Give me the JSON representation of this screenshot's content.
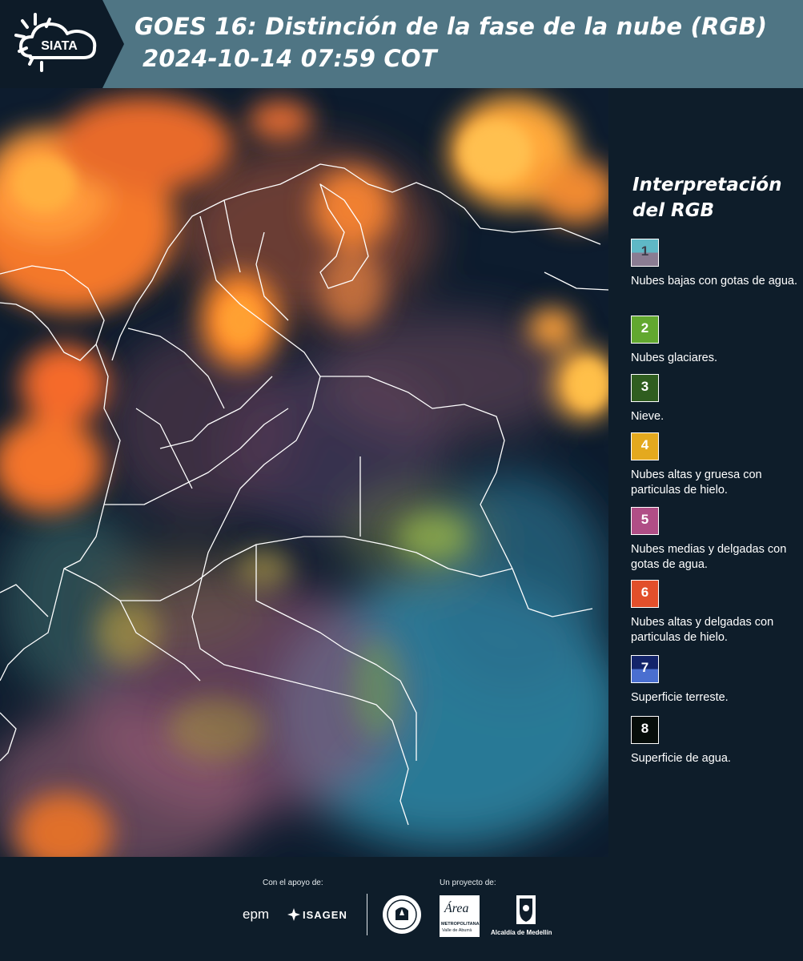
{
  "header": {
    "logo_text": "SIATA",
    "title_line1": "GOES 16: Distinción de la fase de la nube (RGB)",
    "title_line2": "2024-10-14 07:59 COT"
  },
  "legend": {
    "title_line1": "Interpretación",
    "title_line2": "del RGB",
    "items": [
      {
        "number": "1",
        "label": "Nubes bajas con gotas de agua.",
        "color_top": "#5fb8c6",
        "color_bottom": "#8a7c92",
        "number_color": "#3d3d4a"
      },
      {
        "number": "2",
        "label": "Nubes glaciares.",
        "color_top": "#62a82f",
        "color_bottom": "#62a82f",
        "number_color": "#ffffff"
      },
      {
        "number": "3",
        "label": "Nieve.",
        "color_top": "#2f5d1f",
        "color_bottom": "#2f5d1f",
        "number_color": "#ffffff"
      },
      {
        "number": "4",
        "label": "Nubes altas y gruesa con particulas de hielo.",
        "color_top": "#e4a91e",
        "color_bottom": "#e4a91e",
        "number_color": "#ffffff"
      },
      {
        "number": "5",
        "label": "Nubes medias y delgadas con gotas de agua.",
        "color_top": "#b04e86",
        "color_bottom": "#b04e86",
        "number_color": "#ffffff"
      },
      {
        "number": "6",
        "label": "Nubes altas y delgadas con particulas de hielo.",
        "color_top": "#e24f2b",
        "color_bottom": "#e24f2b",
        "number_color": "#ffffff"
      },
      {
        "number": "7",
        "label": "Superficie terreste.",
        "color_top": "#13246a",
        "color_bottom": "#4a6fd0",
        "number_color": "#ffffff"
      },
      {
        "number": "8",
        "label": "Superficie de agua.",
        "color_top": "#060d0a",
        "color_bottom": "#060d0a",
        "number_color": "#ffffff"
      }
    ]
  },
  "footer": {
    "support_label": "Con el apoyo de:",
    "project_label": "Un proyecto de:",
    "sponsor1": "epm",
    "sponsor2": "ISAGEN",
    "area_text": "Área",
    "area_sub1": "METROPOLITANA",
    "area_sub2": "Valle de Aburrá",
    "alcaldia": "Alcaldía de Medellín"
  },
  "map": {
    "colors": {
      "ocean": "#0d1c2e",
      "orange_cloud": "#f07a2a",
      "bright_cloud": "#ffb43c",
      "cyan_cloud": "#3f9bb8",
      "pink_cloud": "#a4647e",
      "green_cloud": "#8aa84a",
      "borders": "#ffffff"
    }
  }
}
